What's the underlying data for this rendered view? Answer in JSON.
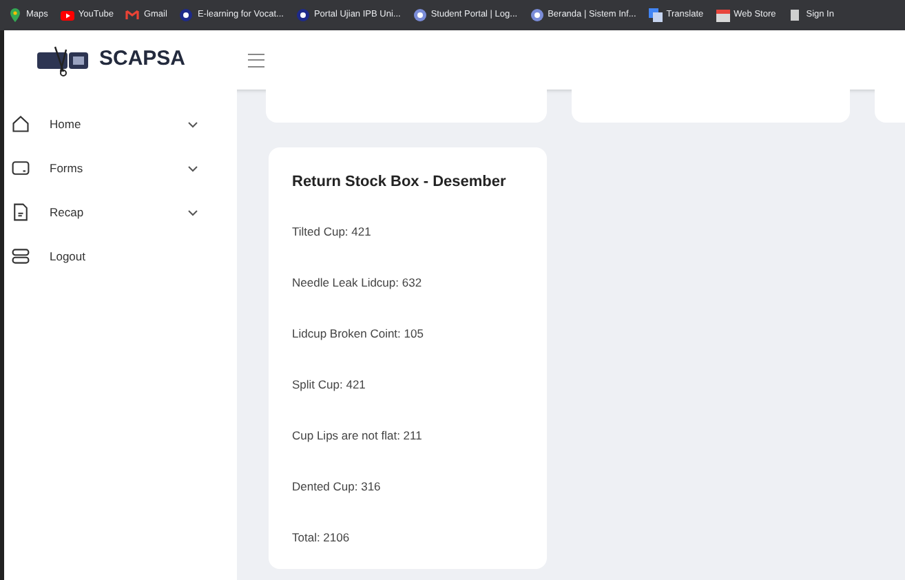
{
  "bookmarks": [
    {
      "label": "Maps",
      "kind": "pin"
    },
    {
      "label": "YouTube",
      "kind": "video"
    },
    {
      "label": "Gmail",
      "kind": "mail"
    },
    {
      "label": "E-learning for Vocat...",
      "kind": "globe"
    },
    {
      "label": "Portal Ujian IPB Uni...",
      "kind": "globe"
    },
    {
      "label": "Student Portal | Log...",
      "kind": "globe-light"
    },
    {
      "label": "Beranda | Sistem Inf...",
      "kind": "globe-light"
    },
    {
      "label": "Translate",
      "kind": "translate"
    },
    {
      "label": "Web Store",
      "kind": "store"
    },
    {
      "label": "Sign In",
      "kind": "page"
    }
  ],
  "brand": "SCAPSA",
  "sidebar": {
    "items": [
      {
        "label": "Home",
        "kind": "home",
        "expandable": true
      },
      {
        "label": "Forms",
        "kind": "forms",
        "expandable": true
      },
      {
        "label": "Recap",
        "kind": "file",
        "expandable": true
      },
      {
        "label": "Logout",
        "kind": "logout",
        "expandable": false
      }
    ]
  },
  "card": {
    "title": "Return Stock Box - Desember",
    "lines": [
      "Tilted Cup: 421",
      "Needle Leak Lidcup: 632",
      "Lidcup Broken Coint: 105",
      "Split Cup: 421",
      "Cup Lips are not flat: 211",
      "Dented Cup: 316",
      "Total: 2106"
    ]
  }
}
